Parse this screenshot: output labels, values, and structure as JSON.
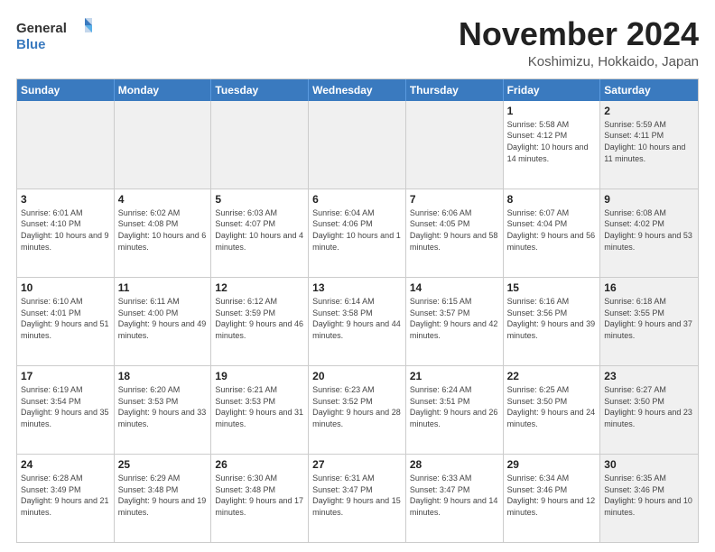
{
  "logo": {
    "general": "General",
    "blue": "Blue"
  },
  "title": "November 2024",
  "location": "Koshimizu, Hokkaido, Japan",
  "header_days": [
    "Sunday",
    "Monday",
    "Tuesday",
    "Wednesday",
    "Thursday",
    "Friday",
    "Saturday"
  ],
  "weeks": [
    [
      {
        "day": "",
        "info": "",
        "shaded": true
      },
      {
        "day": "",
        "info": "",
        "shaded": true
      },
      {
        "day": "",
        "info": "",
        "shaded": true
      },
      {
        "day": "",
        "info": "",
        "shaded": true
      },
      {
        "day": "",
        "info": "",
        "shaded": true
      },
      {
        "day": "1",
        "info": "Sunrise: 5:58 AM\nSunset: 4:12 PM\nDaylight: 10 hours and 14 minutes.",
        "shaded": false
      },
      {
        "day": "2",
        "info": "Sunrise: 5:59 AM\nSunset: 4:11 PM\nDaylight: 10 hours and 11 minutes.",
        "shaded": true
      }
    ],
    [
      {
        "day": "3",
        "info": "Sunrise: 6:01 AM\nSunset: 4:10 PM\nDaylight: 10 hours and 9 minutes.",
        "shaded": false
      },
      {
        "day": "4",
        "info": "Sunrise: 6:02 AM\nSunset: 4:08 PM\nDaylight: 10 hours and 6 minutes.",
        "shaded": false
      },
      {
        "day": "5",
        "info": "Sunrise: 6:03 AM\nSunset: 4:07 PM\nDaylight: 10 hours and 4 minutes.",
        "shaded": false
      },
      {
        "day": "6",
        "info": "Sunrise: 6:04 AM\nSunset: 4:06 PM\nDaylight: 10 hours and 1 minute.",
        "shaded": false
      },
      {
        "day": "7",
        "info": "Sunrise: 6:06 AM\nSunset: 4:05 PM\nDaylight: 9 hours and 58 minutes.",
        "shaded": false
      },
      {
        "day": "8",
        "info": "Sunrise: 6:07 AM\nSunset: 4:04 PM\nDaylight: 9 hours and 56 minutes.",
        "shaded": false
      },
      {
        "day": "9",
        "info": "Sunrise: 6:08 AM\nSunset: 4:02 PM\nDaylight: 9 hours and 53 minutes.",
        "shaded": true
      }
    ],
    [
      {
        "day": "10",
        "info": "Sunrise: 6:10 AM\nSunset: 4:01 PM\nDaylight: 9 hours and 51 minutes.",
        "shaded": false
      },
      {
        "day": "11",
        "info": "Sunrise: 6:11 AM\nSunset: 4:00 PM\nDaylight: 9 hours and 49 minutes.",
        "shaded": false
      },
      {
        "day": "12",
        "info": "Sunrise: 6:12 AM\nSunset: 3:59 PM\nDaylight: 9 hours and 46 minutes.",
        "shaded": false
      },
      {
        "day": "13",
        "info": "Sunrise: 6:14 AM\nSunset: 3:58 PM\nDaylight: 9 hours and 44 minutes.",
        "shaded": false
      },
      {
        "day": "14",
        "info": "Sunrise: 6:15 AM\nSunset: 3:57 PM\nDaylight: 9 hours and 42 minutes.",
        "shaded": false
      },
      {
        "day": "15",
        "info": "Sunrise: 6:16 AM\nSunset: 3:56 PM\nDaylight: 9 hours and 39 minutes.",
        "shaded": false
      },
      {
        "day": "16",
        "info": "Sunrise: 6:18 AM\nSunset: 3:55 PM\nDaylight: 9 hours and 37 minutes.",
        "shaded": true
      }
    ],
    [
      {
        "day": "17",
        "info": "Sunrise: 6:19 AM\nSunset: 3:54 PM\nDaylight: 9 hours and 35 minutes.",
        "shaded": false
      },
      {
        "day": "18",
        "info": "Sunrise: 6:20 AM\nSunset: 3:53 PM\nDaylight: 9 hours and 33 minutes.",
        "shaded": false
      },
      {
        "day": "19",
        "info": "Sunrise: 6:21 AM\nSunset: 3:53 PM\nDaylight: 9 hours and 31 minutes.",
        "shaded": false
      },
      {
        "day": "20",
        "info": "Sunrise: 6:23 AM\nSunset: 3:52 PM\nDaylight: 9 hours and 28 minutes.",
        "shaded": false
      },
      {
        "day": "21",
        "info": "Sunrise: 6:24 AM\nSunset: 3:51 PM\nDaylight: 9 hours and 26 minutes.",
        "shaded": false
      },
      {
        "day": "22",
        "info": "Sunrise: 6:25 AM\nSunset: 3:50 PM\nDaylight: 9 hours and 24 minutes.",
        "shaded": false
      },
      {
        "day": "23",
        "info": "Sunrise: 6:27 AM\nSunset: 3:50 PM\nDaylight: 9 hours and 23 minutes.",
        "shaded": true
      }
    ],
    [
      {
        "day": "24",
        "info": "Sunrise: 6:28 AM\nSunset: 3:49 PM\nDaylight: 9 hours and 21 minutes.",
        "shaded": false
      },
      {
        "day": "25",
        "info": "Sunrise: 6:29 AM\nSunset: 3:48 PM\nDaylight: 9 hours and 19 minutes.",
        "shaded": false
      },
      {
        "day": "26",
        "info": "Sunrise: 6:30 AM\nSunset: 3:48 PM\nDaylight: 9 hours and 17 minutes.",
        "shaded": false
      },
      {
        "day": "27",
        "info": "Sunrise: 6:31 AM\nSunset: 3:47 PM\nDaylight: 9 hours and 15 minutes.",
        "shaded": false
      },
      {
        "day": "28",
        "info": "Sunrise: 6:33 AM\nSunset: 3:47 PM\nDaylight: 9 hours and 14 minutes.",
        "shaded": false
      },
      {
        "day": "29",
        "info": "Sunrise: 6:34 AM\nSunset: 3:46 PM\nDaylight: 9 hours and 12 minutes.",
        "shaded": false
      },
      {
        "day": "30",
        "info": "Sunrise: 6:35 AM\nSunset: 3:46 PM\nDaylight: 9 hours and 10 minutes.",
        "shaded": true
      }
    ]
  ]
}
